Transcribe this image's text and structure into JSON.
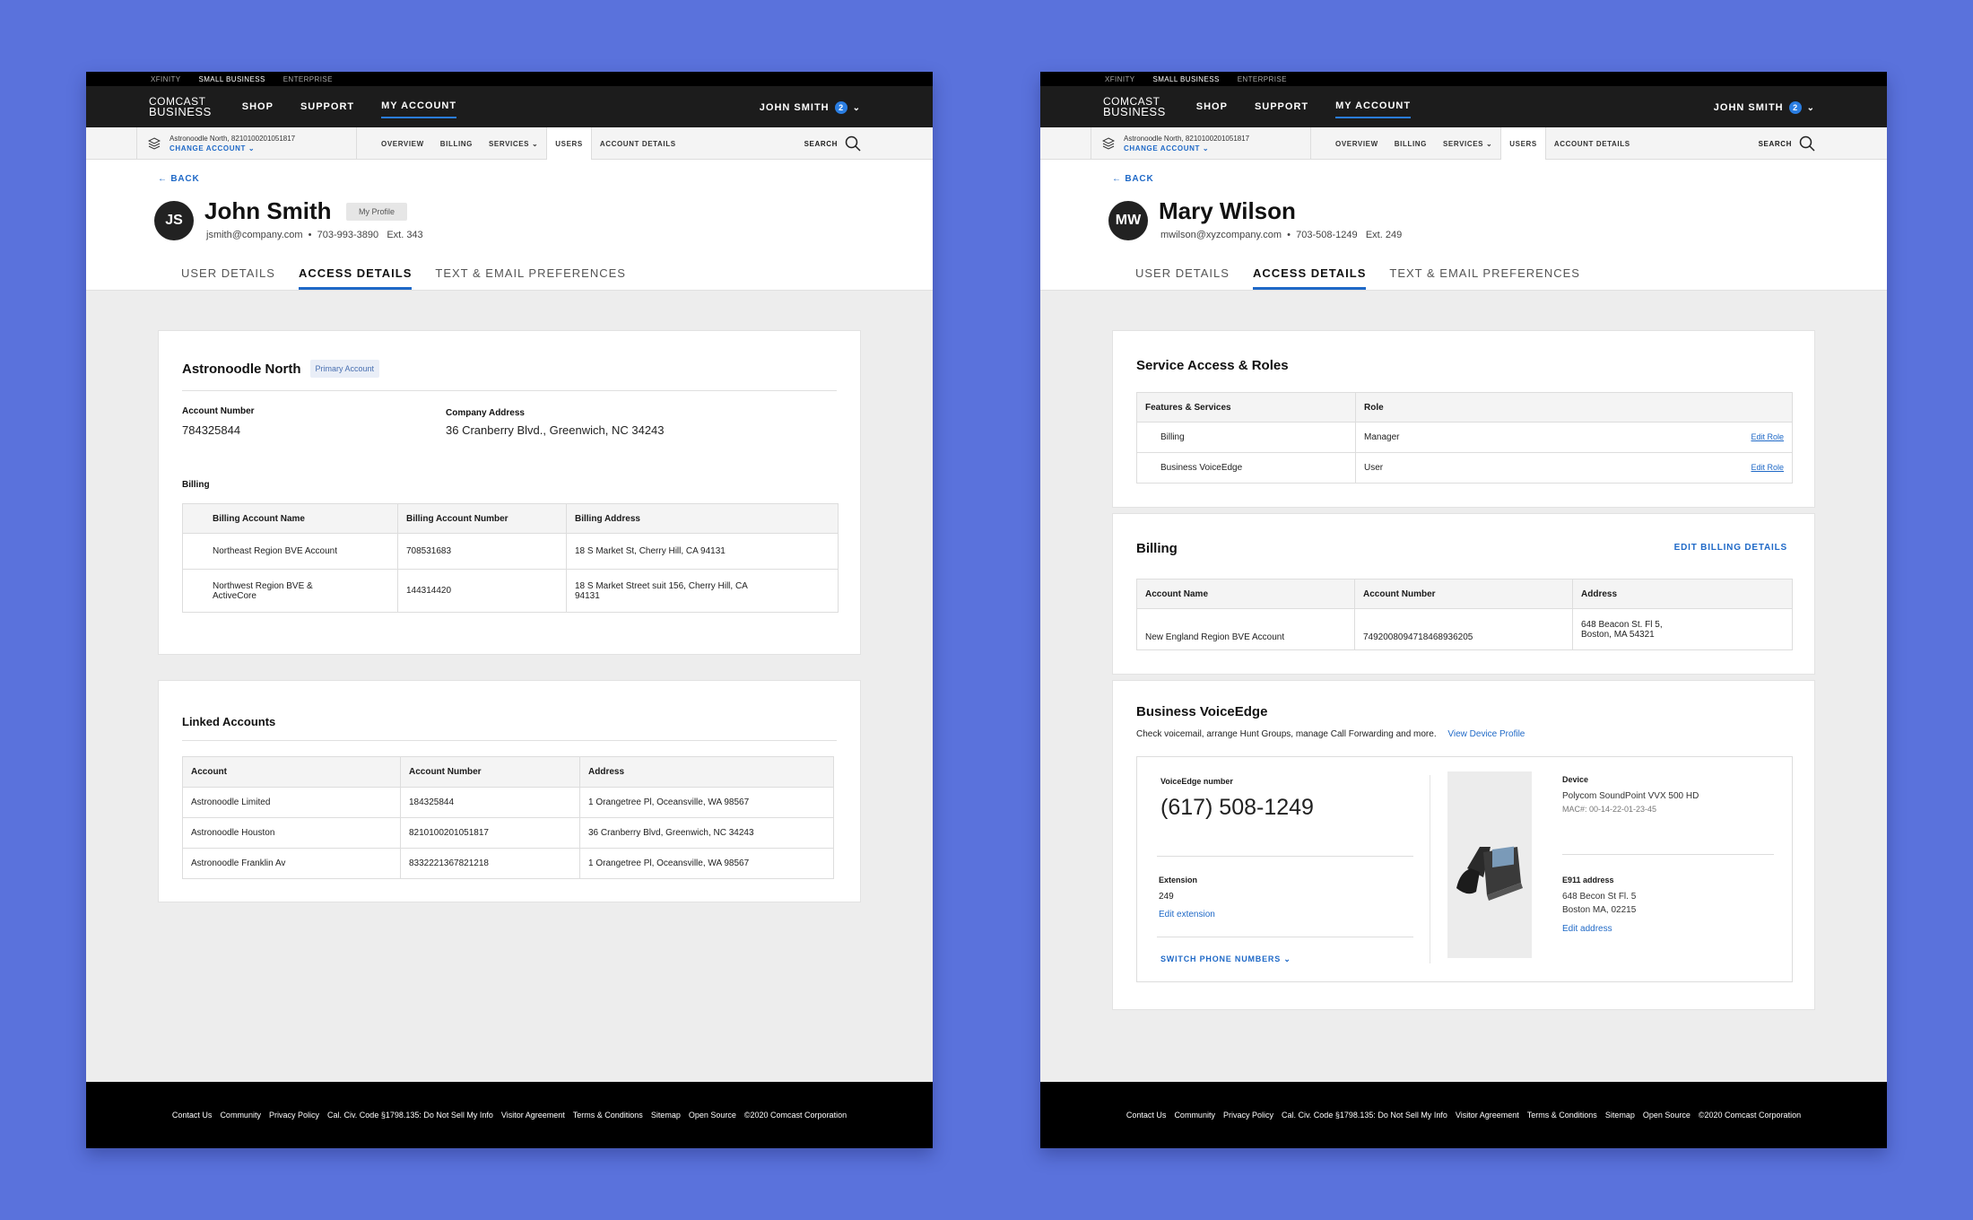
{
  "colors": {
    "background": "#5a72dc",
    "accent": "#1f69c7",
    "nav_dark": "#1c1c1c"
  },
  "header": {
    "util_links": [
      "XFINITY",
      "SMALL BUSINESS",
      "ENTERPRISE"
    ],
    "logo_top": "COMCAST",
    "logo_bottom": "BUSINESS",
    "nav": [
      "SHOP",
      "SUPPORT",
      "MY ACCOUNT"
    ],
    "user_name": "JOHN SMITH",
    "user_badge": "2",
    "account_line": "Astronoodle North, 8210100201051817",
    "change_account": "CHANGE ACCOUNT",
    "subnav": [
      "OVERVIEW",
      "BILLING",
      "SERVICES",
      "USERS",
      "ACCOUNT DETAILS"
    ],
    "search": "SEARCH"
  },
  "tabs": [
    "USER DETAILS",
    "ACCESS DETAILS",
    "TEXT & EMAIL PREFERENCES"
  ],
  "back": "BACK",
  "left": {
    "initials": "JS",
    "name": "John Smith",
    "tag": "My Profile",
    "email": "jsmith@company.com",
    "phone": "703-993-3890",
    "ext": "Ext. 343",
    "account_card": {
      "title": "Astronoodle North",
      "pill": "Primary Account",
      "acct_num_label": "Account Number",
      "acct_num": "784325844",
      "address_label": "Company Address",
      "address": "36 Cranberry Blvd., Greenwich, NC 34243",
      "billing_label": "Billing",
      "billing_headers": [
        "Billing Account Name",
        "Billing Account Number",
        "Billing Address"
      ],
      "billing_rows": [
        [
          "Northeast Region BVE Account",
          "708531683",
          "18 S Market St, Cherry Hill, CA 94131"
        ],
        [
          "Northwest Region BVE & ActiveCore",
          "144314420",
          "18 S Market Street suit 156, Cherry Hill, CA 94131"
        ]
      ]
    },
    "linked_card": {
      "title": "Linked Accounts",
      "headers": [
        "Account",
        "Account Number",
        "Address"
      ],
      "rows": [
        [
          "Astronoodle Limited",
          "184325844",
          "1 Orangetree Pl, Oceansville, WA 98567"
        ],
        [
          "Astronoodle Houston",
          "8210100201051817",
          "36 Cranberry Blvd, Greenwich, NC 34243"
        ],
        [
          "Astronoodle Franklin Av",
          "8332221367821218",
          "1 Orangetree Pl, Oceansville, WA 98567"
        ]
      ]
    }
  },
  "right": {
    "initials": "MW",
    "name": "Mary Wilson",
    "email": "mwilson@xyzcompany.com",
    "phone": "703-508-1249",
    "ext": "Ext. 249",
    "service_card": {
      "title": "Service Access & Roles",
      "headers": [
        "Features & Services",
        "Role"
      ],
      "rows": [
        {
          "feature": "Billing",
          "role": "Manager",
          "action": "Edit Role"
        },
        {
          "feature": "Business VoiceEdge",
          "role": "User",
          "action": "Edit Role"
        }
      ]
    },
    "billing_card": {
      "title": "Billing",
      "action": "EDIT BILLING DETAILS",
      "headers": [
        "Account Name",
        "Account Number",
        "Address"
      ],
      "row": [
        "New England Region BVE Account",
        "7492008094718468936205",
        "648 Beacon St. Fl 5,",
        "Boston, MA 54321"
      ]
    },
    "voice_card": {
      "title": "Business VoiceEdge",
      "desc": "Check voicemail, arrange Hunt Groups, manage Call Forwarding and more.",
      "device_link": "View Device Profile",
      "number_label": "VoiceEdge number",
      "number": "(617) 508-1249",
      "ext_label": "Extension",
      "ext": "249",
      "edit_ext": "Edit extension",
      "switch": "SWITCH PHONE NUMBERS",
      "device_label": "Device",
      "device_name": "Polycom SoundPoint VVX 500 HD",
      "mac": "MAC#: 00-14-22-01-23-45",
      "e911_label": "E911 address",
      "e911_line1": "648 Becon St Fl. 5",
      "e911_line2": "Boston MA, 02215",
      "edit_address": "Edit address"
    }
  },
  "footer": [
    "Contact Us",
    "Community",
    "Privacy Policy",
    "Cal. Civ. Code §1798.135: Do Not Sell My Info",
    "Visitor Agreement",
    "Terms & Conditions",
    "Sitemap",
    "Open Source",
    "©2020 Comcast Corporation"
  ]
}
